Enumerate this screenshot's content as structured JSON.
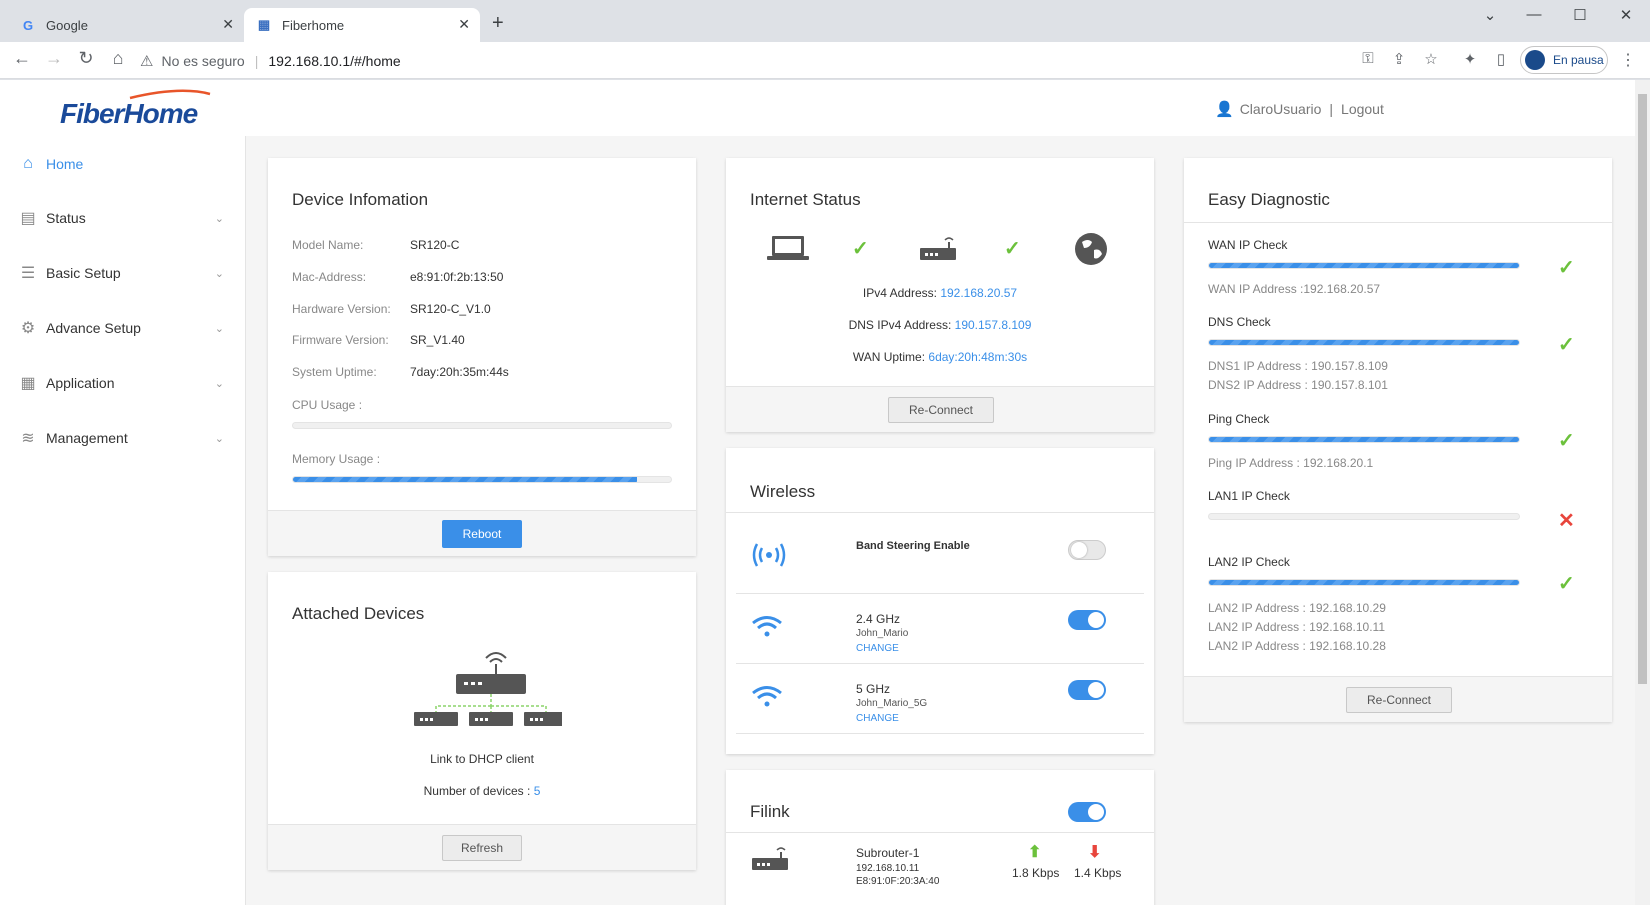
{
  "browser": {
    "tabs": [
      {
        "title": "Google",
        "favicon": "google-icon"
      },
      {
        "title": "Fiberhome",
        "favicon": "fiberhome-icon"
      }
    ],
    "security_label": "No es seguro",
    "url": "192.168.10.1/#/home",
    "profile_label": "En pausa"
  },
  "header": {
    "logo_text": "FiberHome",
    "username": "ClaroUsuario",
    "separator": "|",
    "logout_label": "Logout"
  },
  "sidebar": {
    "items": [
      {
        "label": "Home",
        "icon": "home-icon"
      },
      {
        "label": "Status",
        "icon": "status-icon"
      },
      {
        "label": "Basic Setup",
        "icon": "basic-setup-icon"
      },
      {
        "label": "Advance Setup",
        "icon": "gear-icon"
      },
      {
        "label": "Application",
        "icon": "application-icon"
      },
      {
        "label": "Management",
        "icon": "layers-icon"
      }
    ]
  },
  "device_info": {
    "title": "Device Infomation",
    "rows": [
      {
        "label": "Model Name:",
        "value": "SR120-C"
      },
      {
        "label": "Mac-Address:",
        "value": "e8:91:0f:2b:13:50"
      },
      {
        "label": "Hardware Version:",
        "value": "SR120-C_V1.0"
      },
      {
        "label": "Firmware Version:",
        "value": "SR_V1.40"
      },
      {
        "label": "System Uptime:",
        "value": "7day:20h:35m:44s"
      }
    ],
    "cpu_label": "CPU Usage :",
    "cpu_usage": 0,
    "memory_label": "Memory Usage :",
    "memory_usage": 0.91,
    "reboot_label": "Reboot"
  },
  "attached": {
    "title": "Attached Devices",
    "link_text": "Link to DHCP client",
    "count_label": "Number of devices :",
    "count_value": "5",
    "refresh_label": "Refresh"
  },
  "internet": {
    "title": "Internet Status",
    "ipv4_label": "IPv4 Address:",
    "ipv4_value": "192.168.20.57",
    "dns_label": "DNS IPv4 Address:",
    "dns_value": "190.157.8.109",
    "uptime_label": "WAN Uptime:",
    "uptime_value": "6day:20h:48m:30s",
    "reconnect_label": "Re-Connect"
  },
  "wireless": {
    "title": "Wireless",
    "band_steering_label": "Band Steering Enable",
    "band_steering_on": false,
    "bands": [
      {
        "name": "2.4 GHz",
        "ssid": "John_Mario",
        "change": "CHANGE",
        "on": true
      },
      {
        "name": "5 GHz",
        "ssid": "John_Mario_5G",
        "change": "CHANGE",
        "on": true
      }
    ]
  },
  "filink": {
    "title": "Filink",
    "on": true,
    "device_name": "Subrouter-1",
    "device_ip": "192.168.10.11",
    "device_mac": "E8:91:0F:20:3A:40",
    "up_speed": "1.8 Kbps",
    "down_speed": "1.4 Kbps"
  },
  "diagnostic": {
    "title": "Easy Diagnostic",
    "checks": [
      {
        "title": "WAN IP Check",
        "progress": 1,
        "status": "ok",
        "info": [
          "WAN IP Address :192.168.20.57"
        ]
      },
      {
        "title": "DNS Check",
        "progress": 1,
        "status": "ok",
        "info": [
          "DNS1 IP Address : 190.157.8.109",
          "DNS2 IP Address : 190.157.8.101"
        ]
      },
      {
        "title": "Ping Check",
        "progress": 1,
        "status": "ok",
        "info": [
          "Ping IP Address : 192.168.20.1"
        ]
      },
      {
        "title": "LAN1 IP Check",
        "progress": 0,
        "status": "fail",
        "info": []
      },
      {
        "title": "LAN2 IP Check",
        "progress": 1,
        "status": "ok",
        "info": [
          "LAN2 IP Address : 192.168.10.29",
          "LAN2 IP Address : 192.168.10.11",
          "LAN2 IP Address : 192.168.10.28"
        ]
      }
    ],
    "reconnect_label": "Re-Connect"
  },
  "colors": {
    "accent": "#3a8fe8",
    "ok": "#6cc13c",
    "fail": "#e8453c"
  }
}
